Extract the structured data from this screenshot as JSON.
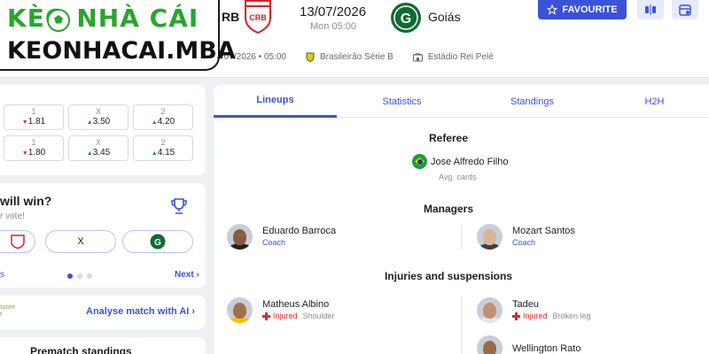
{
  "watermark": {
    "line1": "KÈO NHÀ CÁI",
    "line2": "KEONHACAI.MBA"
  },
  "match": {
    "home_short": "RB",
    "date": "13/07/2026",
    "time": "Mon 05:00",
    "away_name": "Goiás",
    "meta_datetime": "/07/2026 • 05:00",
    "competition": "Brasileirão Série B",
    "stadium": "Estádio Rei Pelé",
    "home_crest_text": "CRB",
    "away_crest_text": "G"
  },
  "header": {
    "favourite_label": "FAVOURITE"
  },
  "odds": {
    "rows": [
      [
        {
          "label": "1",
          "value": "1.81",
          "trend": "down"
        },
        {
          "label": "X",
          "value": "3.50",
          "trend": "up"
        },
        {
          "label": "2",
          "value": "4.20",
          "trend": "up"
        }
      ],
      [
        {
          "label": "1",
          "value": "1.80",
          "trend": "down"
        },
        {
          "label": "X",
          "value": "3.45",
          "trend": "up"
        },
        {
          "label": "2",
          "value": "4.15",
          "trend": "up"
        }
      ]
    ]
  },
  "vote": {
    "question": "will win?",
    "subtitle": "r vote!",
    "draw_label": "X",
    "prev_label": "s",
    "next_label": "Next"
  },
  "ai": {
    "logo_text": "score\nt",
    "link": "Analyse match with AI"
  },
  "standings": {
    "title": "Prematch standings"
  },
  "tabs": [
    "Lineups",
    "Statistics",
    "Standings",
    "H2H"
  ],
  "referee": {
    "title": "Referee",
    "name": "Jose Alfredo Filho",
    "avg_cards": "Avg. cards"
  },
  "managers": {
    "title": "Managers",
    "home": {
      "name": "Eduardo Barroca",
      "role": "Coach"
    },
    "away": {
      "name": "Mozart Santos",
      "role": "Coach"
    }
  },
  "injuries": {
    "title": "Injuries and suspensions",
    "home": [
      {
        "name": "Matheus Albino",
        "status": "Injured",
        "detail": "Shoulder"
      }
    ],
    "away": [
      {
        "name": "Tadeu",
        "status": "Injured",
        "detail": "Broken leg"
      },
      {
        "name": "Wellington Rato",
        "status": "",
        "detail": ""
      }
    ]
  },
  "colors": {
    "accent": "#3b52d6",
    "injured": "#d62e2e",
    "odds_up": "#1f9d3b",
    "odds_down": "#d62e2e",
    "watermark_green": "#2aa52e"
  }
}
